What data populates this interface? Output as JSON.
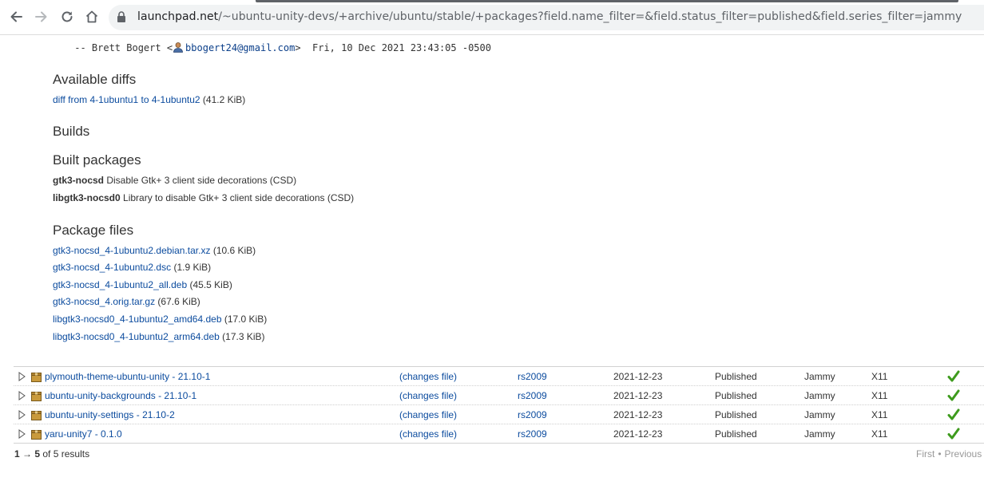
{
  "browser": {
    "url_host": "launchpad.net",
    "url_path": "/~ubuntu-unity-devs/+archive/ubuntu/stable/+packages?field.name_filter=&field.status_filter=published&field.series_filter=jammy"
  },
  "changelog": {
    "sig_prefix": " -- Brett Bogert <",
    "email": "bbogert24@gmail.com",
    "sig_suffix": ">  Fri, 10 Dec 2021 23:43:05 -0500"
  },
  "diffs": {
    "heading": "Available diffs",
    "link": "diff from 4-1ubuntu1 to 4-1ubuntu2",
    "size": " (41.2 KiB)"
  },
  "builds": {
    "heading": "Builds"
  },
  "built_packages": {
    "heading": "Built packages",
    "items": [
      {
        "name": "gtk3-nocsd",
        "desc": " Disable Gtk+ 3 client side decorations (CSD)"
      },
      {
        "name": "libgtk3-nocsd0",
        "desc": " Library to disable Gtk+ 3 client side decorations (CSD)"
      }
    ]
  },
  "package_files": {
    "heading": "Package files",
    "files": [
      {
        "name": "gtk3-nocsd_4-1ubuntu2.debian.tar.xz",
        "size": " (10.6 KiB)"
      },
      {
        "name": "gtk3-nocsd_4-1ubuntu2.dsc",
        "size": " (1.9 KiB)"
      },
      {
        "name": "gtk3-nocsd_4-1ubuntu2_all.deb",
        "size": " (45.5 KiB)"
      },
      {
        "name": "gtk3-nocsd_4.orig.tar.gz",
        "size": " (67.6 KiB)"
      },
      {
        "name": "libgtk3-nocsd0_4-1ubuntu2_amd64.deb",
        "size": " (17.0 KiB)"
      },
      {
        "name": "libgtk3-nocsd0_4-1ubuntu2_arm64.deb",
        "size": " (17.3 KiB)"
      }
    ]
  },
  "table": {
    "rows": [
      {
        "package": "plymouth-theme-ubuntu-unity - 21.10-1",
        "changes": "(changes file)",
        "uploader": "rs2009",
        "date": "2021-12-23",
        "status": "Published",
        "series": "Jammy",
        "section": "X11"
      },
      {
        "package": "ubuntu-unity-backgrounds - 21.10-1",
        "changes": "(changes file)",
        "uploader": "rs2009",
        "date": "2021-12-23",
        "status": "Published",
        "series": "Jammy",
        "section": "X11"
      },
      {
        "package": "ubuntu-unity-settings - 21.10-2",
        "changes": "(changes file)",
        "uploader": "rs2009",
        "date": "2021-12-23",
        "status": "Published",
        "series": "Jammy",
        "section": "X11"
      },
      {
        "package": "yaru-unity7 - 0.1.0",
        "changes": "(changes file)",
        "uploader": "rs2009",
        "date": "2021-12-23",
        "status": "Published",
        "series": "Jammy",
        "section": "X11"
      }
    ]
  },
  "results": {
    "start": "1",
    "arrow": " → ",
    "end": "5",
    "of_label": " of ",
    "total": "5",
    "suffix": " results"
  },
  "pager": {
    "first": "First",
    "sep": "•",
    "previous": "Previous"
  },
  "colors": {
    "link": "#0b4b9e",
    "ok_green": "#3e9b1d",
    "package_box": "#c99a3c"
  }
}
